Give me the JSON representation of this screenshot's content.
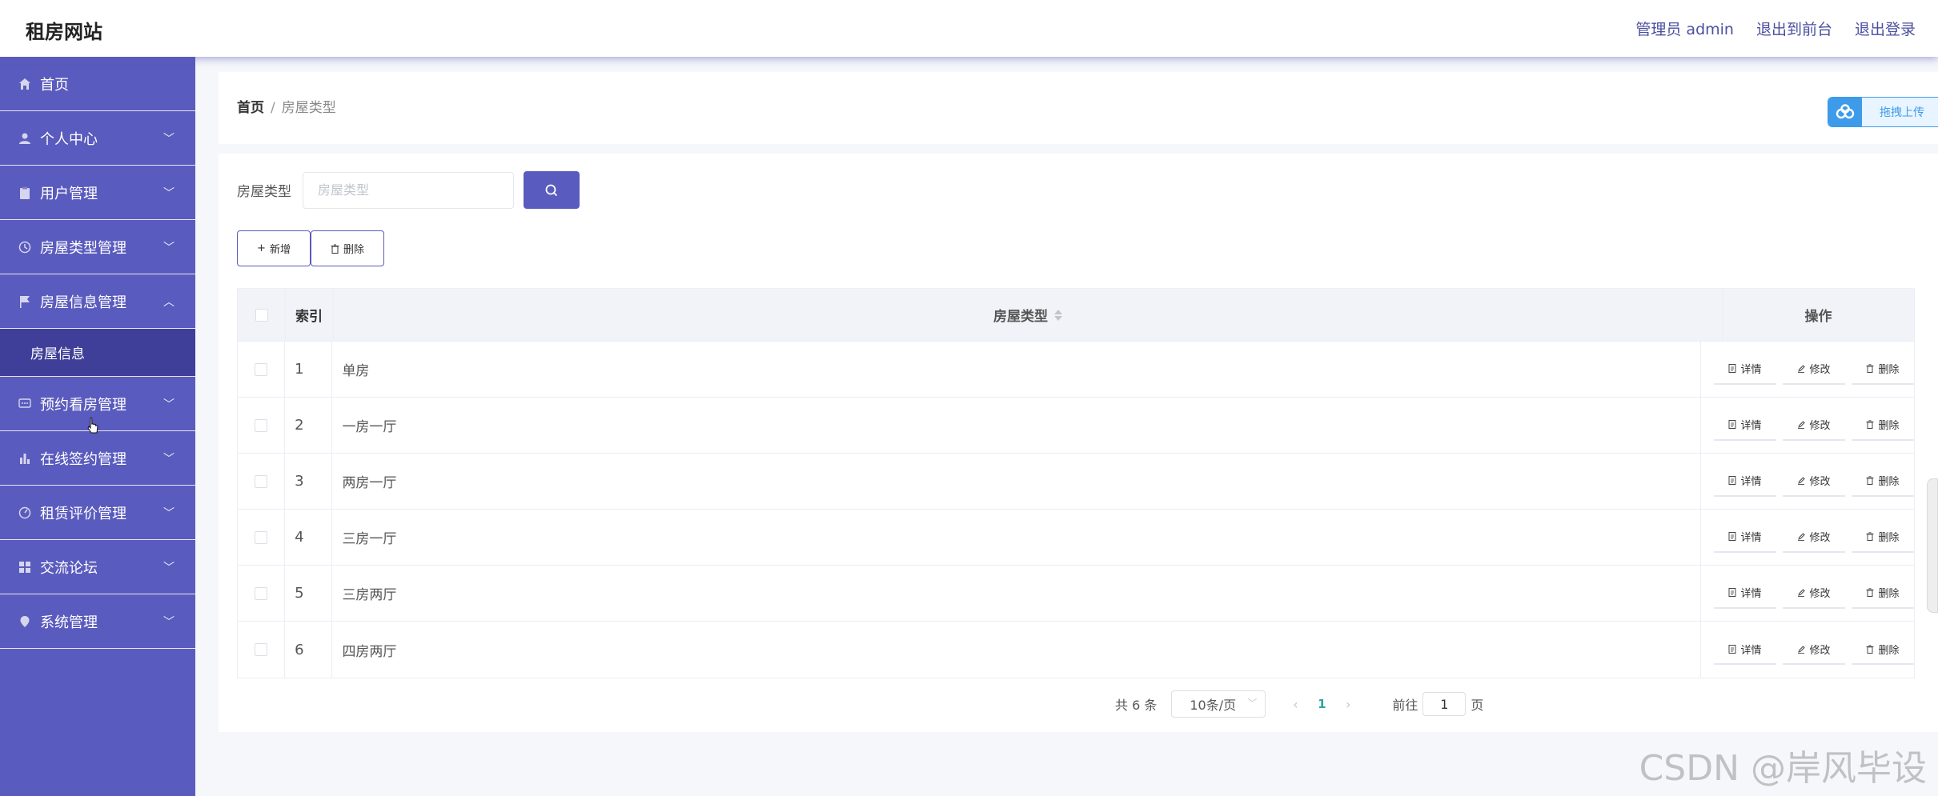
{
  "header": {
    "logo": "租房网站",
    "admin_label": "管理员 admin",
    "to_frontend": "退出到前台",
    "logout": "退出登录"
  },
  "sidebar": {
    "items": [
      {
        "label": "首页",
        "icon": "home-icon"
      },
      {
        "label": "个人中心",
        "icon": "user-icon"
      },
      {
        "label": "用户管理",
        "icon": "clipboard-icon"
      },
      {
        "label": "房屋类型管理",
        "icon": "clock-icon"
      },
      {
        "label": "房屋信息管理",
        "icon": "flag-icon"
      },
      {
        "label": "预约看房管理",
        "icon": "chat-icon"
      },
      {
        "label": "在线签约管理",
        "icon": "bar-chart-icon"
      },
      {
        "label": "租赁评价管理",
        "icon": "gauge-icon"
      },
      {
        "label": "交流论坛",
        "icon": "grid-icon"
      },
      {
        "label": "系统管理",
        "icon": "location-icon"
      }
    ],
    "submenu": {
      "label": "房屋信息"
    }
  },
  "breadcrumb": {
    "home": "首页",
    "separator": "/",
    "current": "房屋类型"
  },
  "upload": {
    "label": "拖拽上传"
  },
  "search": {
    "label": "房屋类型",
    "placeholder": "房屋类型"
  },
  "actions": {
    "add": "新增",
    "delete": "删除"
  },
  "table": {
    "headers": {
      "index": "索引",
      "type": "房屋类型",
      "ops": "操作"
    },
    "rows": [
      {
        "index": "1",
        "type": "单房"
      },
      {
        "index": "2",
        "type": "一房一厅"
      },
      {
        "index": "3",
        "type": "两房一厅"
      },
      {
        "index": "4",
        "type": "三房一厅"
      },
      {
        "index": "5",
        "type": "三房两厅"
      },
      {
        "index": "6",
        "type": "四房两厅"
      }
    ],
    "op_labels": {
      "detail": "详情",
      "edit": "修改",
      "delete": "删除"
    }
  },
  "pagination": {
    "total": "共 6 条",
    "page_size": "10条/页",
    "current_page": "1",
    "goto_prefix": "前往",
    "goto_value": "1",
    "goto_suffix": "页"
  },
  "watermark": "CSDN @岸风毕设",
  "colors": {
    "sidebar": "#5a5bbe",
    "sidebar_active": "#3f3f99",
    "accent": "#5a5bbe",
    "page_active": "#2aa6a0"
  }
}
